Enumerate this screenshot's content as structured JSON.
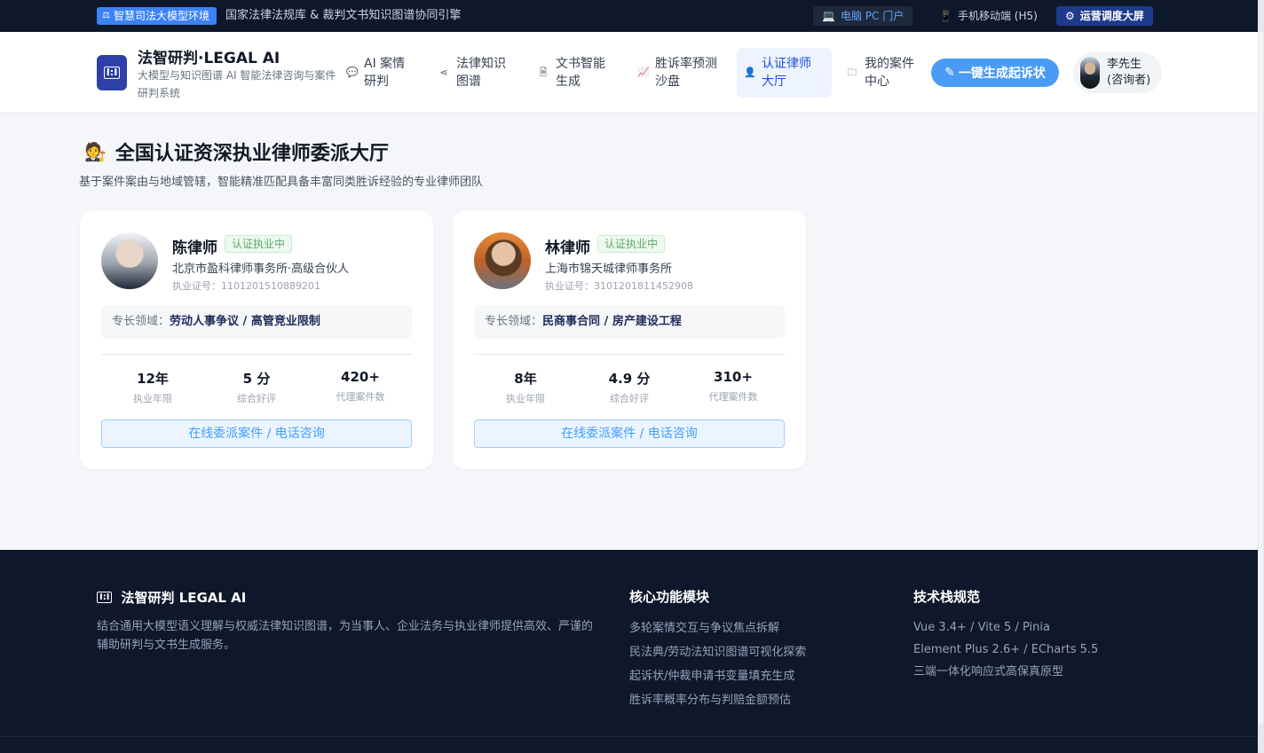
{
  "topbar": {
    "env_badge": "智慧司法大模型环境",
    "description": "国家法律法规库 & 裁判文书知识图谱协同引擎",
    "portals": [
      {
        "label": "电脑 PC 门户",
        "icon": "laptop-icon"
      },
      {
        "label": "手机移动端 (H5)",
        "icon": "mobile-icon"
      },
      {
        "label": "运营调度大屏",
        "icon": "gear-icon"
      }
    ]
  },
  "header": {
    "logo_text": "I:I",
    "brand_title": "法智研判·LEGAL AI",
    "brand_subtitle": "大模型与知识图谱 AI 智能法律咨询与案件研判系统",
    "nav": [
      {
        "label": "AI 案情研判",
        "icon": "chat-icon"
      },
      {
        "label": "法律知识图谱",
        "icon": "share-icon"
      },
      {
        "label": "文书智能生成",
        "icon": "document-icon"
      },
      {
        "label": "胜诉率预测沙盘",
        "icon": "chart-icon"
      },
      {
        "label": "认证律师大厅",
        "icon": "user-icon",
        "active": true
      },
      {
        "label": "我的案件中心",
        "icon": "folder-icon"
      }
    ],
    "cta_label": "一键生成起诉状",
    "user_name": "李先生",
    "user_role": "(咨询者)"
  },
  "main": {
    "title": "全国认证资深执业律师委派大厅",
    "subtitle": "基于案件案由与地域管辖，智能精准匹配具备丰富同类胜诉经验的专业律师团队",
    "lawyers": [
      {
        "name": "陈律师",
        "badge": "认证执业中",
        "firm": "北京市盈科律师事务所·高级合伙人",
        "license": "执业证号：1101201510889201",
        "spec_label": "专长领域：",
        "spec_value": "劳动人事争议 / 高管竞业限制",
        "stats": [
          {
            "value": "12年",
            "label": "执业年限"
          },
          {
            "value": "5 分",
            "label": "综合好评"
          },
          {
            "value": "420+",
            "label": "代理案件数"
          }
        ],
        "button": "在线委派案件 / 电话咨询"
      },
      {
        "name": "林律师",
        "badge": "认证执业中",
        "firm": "上海市锦天城律师事务所",
        "license": "执业证号：3101201811452908",
        "spec_label": "专长领域：",
        "spec_value": "民商事合同 / 房产建设工程",
        "stats": [
          {
            "value": "8年",
            "label": "执业年限"
          },
          {
            "value": "4.9 分",
            "label": "综合好评"
          },
          {
            "value": "310+",
            "label": "代理案件数"
          }
        ],
        "button": "在线委派案件 / 电话咨询"
      }
    ]
  },
  "footer": {
    "brand": "法智研判 LEGAL AI",
    "description": "结合通用大模型语义理解与权威法律知识图谱，为当事人、企业法务与执业律师提供高效、严谨的辅助研判与文书生成服务。",
    "modules_title": "核心功能模块",
    "modules": [
      "多轮案情交互与争议焦点拆解",
      "民法典/劳动法知识图谱可视化探索",
      "起诉状/仲裁申请书变量填充生成",
      "胜诉率概率分布与判赔金额预估"
    ],
    "tech_title": "技术栈规范",
    "tech": [
      "Vue 3.4+ / Vite 5 / Pinia",
      "Element Plus 2.6+ / ECharts 5.5",
      "三端一体化响应式高保真原型"
    ]
  }
}
